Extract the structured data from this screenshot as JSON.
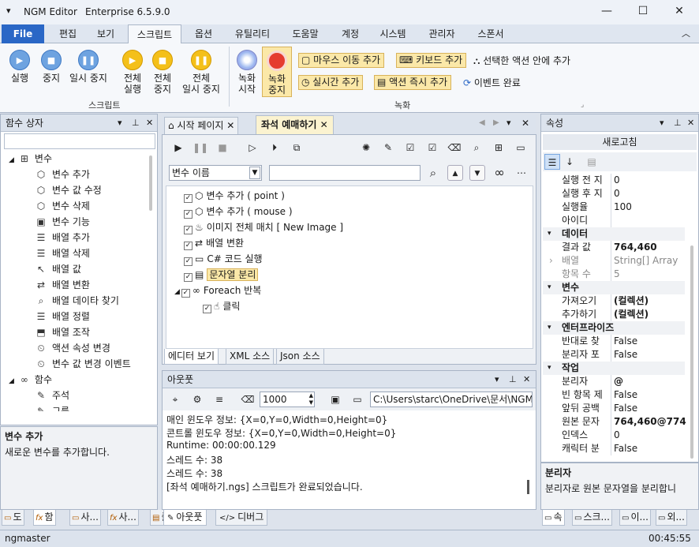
{
  "window": {
    "app_name": "NGM Editor",
    "edition": "Enterprise 6.5.9.0",
    "menu_glyph": "▾",
    "minimize": "—",
    "maximize": "☐",
    "close": "✕"
  },
  "menu": {
    "tabs": [
      "File",
      "편집",
      "보기",
      "스크립트",
      "옵션",
      "유틸리티",
      "도움말",
      "계정",
      "시스템",
      "관리자",
      "스폰서"
    ],
    "active": "스크립트",
    "collapse": "︿"
  },
  "ribbon": {
    "script_group": {
      "label": "스크립트",
      "run": "실행",
      "stop": "중지",
      "pause": "일시 중지",
      "run_all": [
        "전체",
        "실행"
      ],
      "stop_all": [
        "전체",
        "중지"
      ],
      "pause_all": [
        "전체",
        "일시 중지"
      ]
    },
    "record_group": {
      "label": "녹화",
      "record_start": [
        "녹화",
        "시작"
      ],
      "record_stop": [
        "녹화",
        "중지"
      ],
      "mouse_move": "마우스 이동 추가",
      "keyboard": "키보드 추가",
      "realtime": "실시간 추가",
      "action_instant": "액션 즉시 추가",
      "selected_action": "선택한 액션 안에 추가",
      "event_done": "이벤트 완료"
    }
  },
  "func_panel": {
    "title": "함수 상자",
    "category_variables": "변수",
    "items": [
      "변수 추가",
      "변수 값 수정",
      "변수 삭제",
      "변수 기능",
      "배열 추가",
      "배열 삭제",
      "배열 값",
      "배열 변환",
      "배열 데이타 찾기",
      "배열 정렬",
      "배열 조작",
      "액션 속성 변경",
      "변수 값 변경 이벤트"
    ],
    "category_functions": "함수",
    "func_items": [
      "주석",
      "그룹"
    ],
    "desc_title": "변수 추가",
    "desc_text": "새로운 변수를 추가합니다.",
    "bottom_tabs": [
      "도",
      "함",
      "사...",
      "사...",
      "즐"
    ]
  },
  "editor": {
    "tab_start": "시작 페이지",
    "tab_active": "좌석 예매하기",
    "search_select": "변수 이름",
    "search_value": "",
    "actions": [
      {
        "label": "변수 추가 ( point )"
      },
      {
        "label": "변수 추가 ( mouse )"
      },
      {
        "label": "이미지 전체 매치 [ New Image ]"
      },
      {
        "label": "배열 변환"
      },
      {
        "label": "C# 코드 실행"
      },
      {
        "label": "문자열 분리"
      },
      {
        "label": "Foreach 반복"
      },
      {
        "label": "클릭"
      }
    ],
    "bottom_tabs": [
      "에디터 보기",
      "XML 소스",
      "Json 소스"
    ]
  },
  "output": {
    "title": "아웃풋",
    "count": "1000",
    "path": "C:\\Users\\starc\\OneDrive\\문서\\NGM6",
    "lines": [
      "매인 윈도우 정보: {X=0,Y=0,Width=0,Height=0}",
      "콘트롤 윈도우 정보: {X=0,Y=0,Width=0,Height=0}",
      "Runtime: 00:00:00.129",
      "스레드 수: 38",
      "스레드 수: 38",
      "[좌석 예매하기.ngs] 스크립트가 완료되었습니다."
    ],
    "bottom_tabs": [
      "아웃풋",
      "디버그"
    ]
  },
  "props": {
    "title": "속성",
    "refresh": "새로고침",
    "rows": [
      {
        "k": "실행 전 지",
        "v": "0"
      },
      {
        "k": "실행 후 지",
        "v": "0"
      },
      {
        "k": "실행율",
        "v": "100"
      },
      {
        "k": "아이디",
        "v": ""
      },
      {
        "cat": "데이터"
      },
      {
        "k": "결과 값",
        "v": "764,460",
        "b": true
      },
      {
        "k": "배열",
        "v": "String[] Array",
        "g": true
      },
      {
        "k": "항목 수",
        "v": "5",
        "g": true
      },
      {
        "cat": "변수"
      },
      {
        "k": "가져오기",
        "v": "(컬렉션)",
        "b": true
      },
      {
        "k": "추가하기",
        "v": "(컬렉션)",
        "b": true
      },
      {
        "cat": "엔터프라이즈"
      },
      {
        "k": "반대로 찾",
        "v": "False"
      },
      {
        "k": "분리자 포",
        "v": "False"
      },
      {
        "cat": "작업"
      },
      {
        "k": "분리자",
        "v": "@",
        "b": true
      },
      {
        "k": "빈 항목 제",
        "v": "False"
      },
      {
        "k": "앞뒤 공백",
        "v": "False"
      },
      {
        "k": "원본 문자",
        "v": "764,460@774,4",
        "b": true
      },
      {
        "k": "인덱스",
        "v": "0"
      },
      {
        "k": "캐릭터 분",
        "v": "False"
      }
    ],
    "desc_title": "분리자",
    "desc_text": "분리자로 원본 문자열을 분리합니",
    "bottom_tabs": [
      "속",
      "스크...",
      "이...",
      "외..."
    ]
  },
  "status": {
    "user": "ngmaster",
    "time": "00:45:55"
  },
  "colors": {
    "accent": "#2a67c6",
    "highlight": "#fbe8a8"
  }
}
